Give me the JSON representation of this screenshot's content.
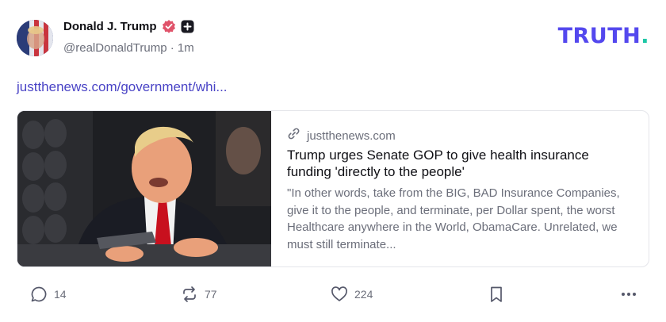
{
  "author": {
    "display_name": "Donald J. Trump",
    "handle": "@realDonaldTrump",
    "separator": "·",
    "time": "1m"
  },
  "brand": {
    "name": "TRUTH",
    "dot": ".",
    "color": "#5448ee",
    "dot_color": "#1ec7a6"
  },
  "post": {
    "link_text": "justthenews.com/government/whi..."
  },
  "link_card": {
    "domain": "justthenews.com",
    "title": "Trump urges Senate GOP to give health insurance funding 'directly to the people'",
    "description": "\"In other words, take from the BIG, BAD Insurance Companies, give it to the people, and terminate, per Dollar spent, the worst Healthcare anywhere in the World, ObamaCare. Unrelated, we must still terminate...",
    "image_icon": "news-photo"
  },
  "actions": {
    "replies": "14",
    "retruths": "77",
    "likes": "224",
    "reply_icon": "speech-bubble-icon",
    "retruth_icon": "repost-arrows-icon",
    "like_icon": "heart-icon",
    "bookmark_icon": "bookmark-icon",
    "more_icon": "more-dots-icon"
  },
  "colors": {
    "link": "#4a44c6",
    "muted": "#6b6e7a",
    "verified": "#e0536a"
  }
}
